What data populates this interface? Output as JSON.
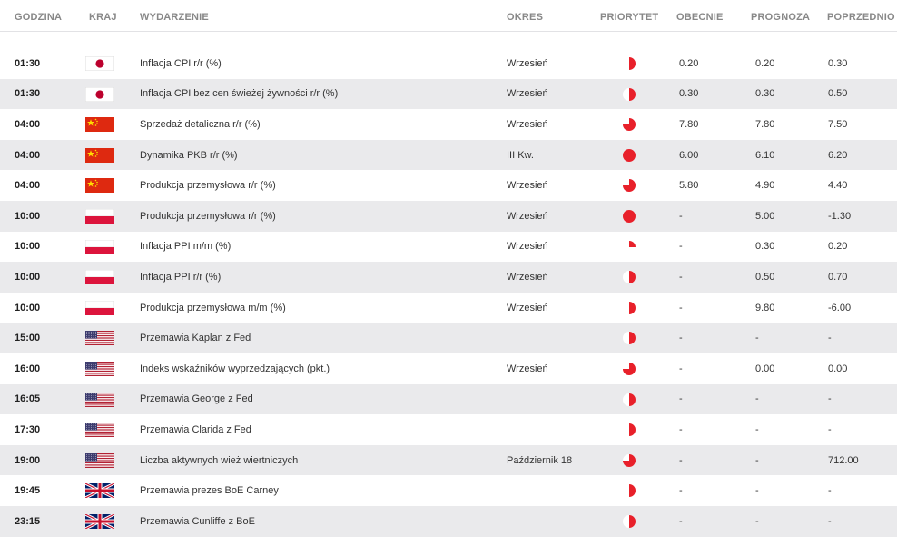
{
  "header": {
    "time": "GODZINA",
    "country": "KRAJ",
    "event": "WYDARZENIE",
    "period": "OKRES",
    "priority": "PRIORYTET",
    "actual": "OBECNIE",
    "forecast": "PROGNOZA",
    "previous": "POPRZEDNIO"
  },
  "colors": {
    "priority": "#e8202a",
    "header_text": "#888888",
    "row_alt": "#eaeaec"
  },
  "rows": [
    {
      "time": "01:30",
      "country": "japan-flag-icon",
      "event": "Inflacja CPI r/r (%)",
      "period": "Wrzesień",
      "priority": 0.5,
      "actual": "0.20",
      "forecast": "0.20",
      "previous": "0.30"
    },
    {
      "time": "01:30",
      "country": "japan-flag-icon",
      "event": "Inflacja CPI bez cen świeżej żywności r/r (%)",
      "period": "Wrzesień",
      "priority": 0.5,
      "actual": "0.30",
      "forecast": "0.30",
      "previous": "0.50"
    },
    {
      "time": "04:00",
      "country": "china-flag-icon",
      "event": "Sprzedaż detaliczna r/r (%)",
      "period": "Wrzesień",
      "priority": 0.75,
      "actual": "7.80",
      "forecast": "7.80",
      "previous": "7.50"
    },
    {
      "time": "04:00",
      "country": "china-flag-icon",
      "event": "Dynamika PKB r/r (%)",
      "period": "III Kw.",
      "priority": 1.0,
      "actual": "6.00",
      "forecast": "6.10",
      "previous": "6.20"
    },
    {
      "time": "04:00",
      "country": "china-flag-icon",
      "event": "Produkcja przemysłowa r/r (%)",
      "period": "Wrzesień",
      "priority": 0.75,
      "actual": "5.80",
      "forecast": "4.90",
      "previous": "4.40"
    },
    {
      "time": "10:00",
      "country": "poland-flag-icon",
      "event": "Produkcja przemysłowa r/r (%)",
      "period": "Wrzesień",
      "priority": 1.0,
      "actual": "-",
      "forecast": "5.00",
      "previous": "-1.30"
    },
    {
      "time": "10:00",
      "country": "poland-flag-icon",
      "event": "Inflacja PPI m/m (%)",
      "period": "Wrzesień",
      "priority": 0.25,
      "actual": "-",
      "forecast": "0.30",
      "previous": "0.20"
    },
    {
      "time": "10:00",
      "country": "poland-flag-icon",
      "event": "Inflacja PPI r/r (%)",
      "period": "Wrzesień",
      "priority": 0.5,
      "actual": "-",
      "forecast": "0.50",
      "previous": "0.70"
    },
    {
      "time": "10:00",
      "country": "poland-flag-icon",
      "event": "Produkcja przemysłowa m/m (%)",
      "period": "Wrzesień",
      "priority": 0.5,
      "actual": "-",
      "forecast": "9.80",
      "previous": "-6.00"
    },
    {
      "time": "15:00",
      "country": "usa-flag-icon",
      "event": "Przemawia Kaplan z Fed",
      "period": "",
      "priority": 0.5,
      "actual": "-",
      "forecast": "-",
      "previous": "-"
    },
    {
      "time": "16:00",
      "country": "usa-flag-icon",
      "event": "Indeks wskaźników wyprzedzających (pkt.)",
      "period": "Wrzesień",
      "priority": 0.75,
      "actual": "-",
      "forecast": "0.00",
      "previous": "0.00"
    },
    {
      "time": "16:05",
      "country": "usa-flag-icon",
      "event": "Przemawia George z Fed",
      "period": "",
      "priority": 0.5,
      "actual": "-",
      "forecast": "-",
      "previous": "-"
    },
    {
      "time": "17:30",
      "country": "usa-flag-icon",
      "event": "Przemawia Clarida z Fed",
      "period": "",
      "priority": 0.5,
      "actual": "-",
      "forecast": "-",
      "previous": "-"
    },
    {
      "time": "19:00",
      "country": "usa-flag-icon",
      "event": "Liczba aktywnych wież wiertniczych",
      "period": "Październik 18",
      "priority": 0.75,
      "actual": "-",
      "forecast": "-",
      "previous": "712.00"
    },
    {
      "time": "19:45",
      "country": "uk-flag-icon",
      "event": "Przemawia prezes BoE Carney",
      "period": "",
      "priority": 0.5,
      "actual": "-",
      "forecast": "-",
      "previous": "-"
    },
    {
      "time": "23:15",
      "country": "uk-flag-icon",
      "event": "Przemawia Cunliffe z BoE",
      "period": "",
      "priority": 0.5,
      "actual": "-",
      "forecast": "-",
      "previous": "-"
    }
  ]
}
